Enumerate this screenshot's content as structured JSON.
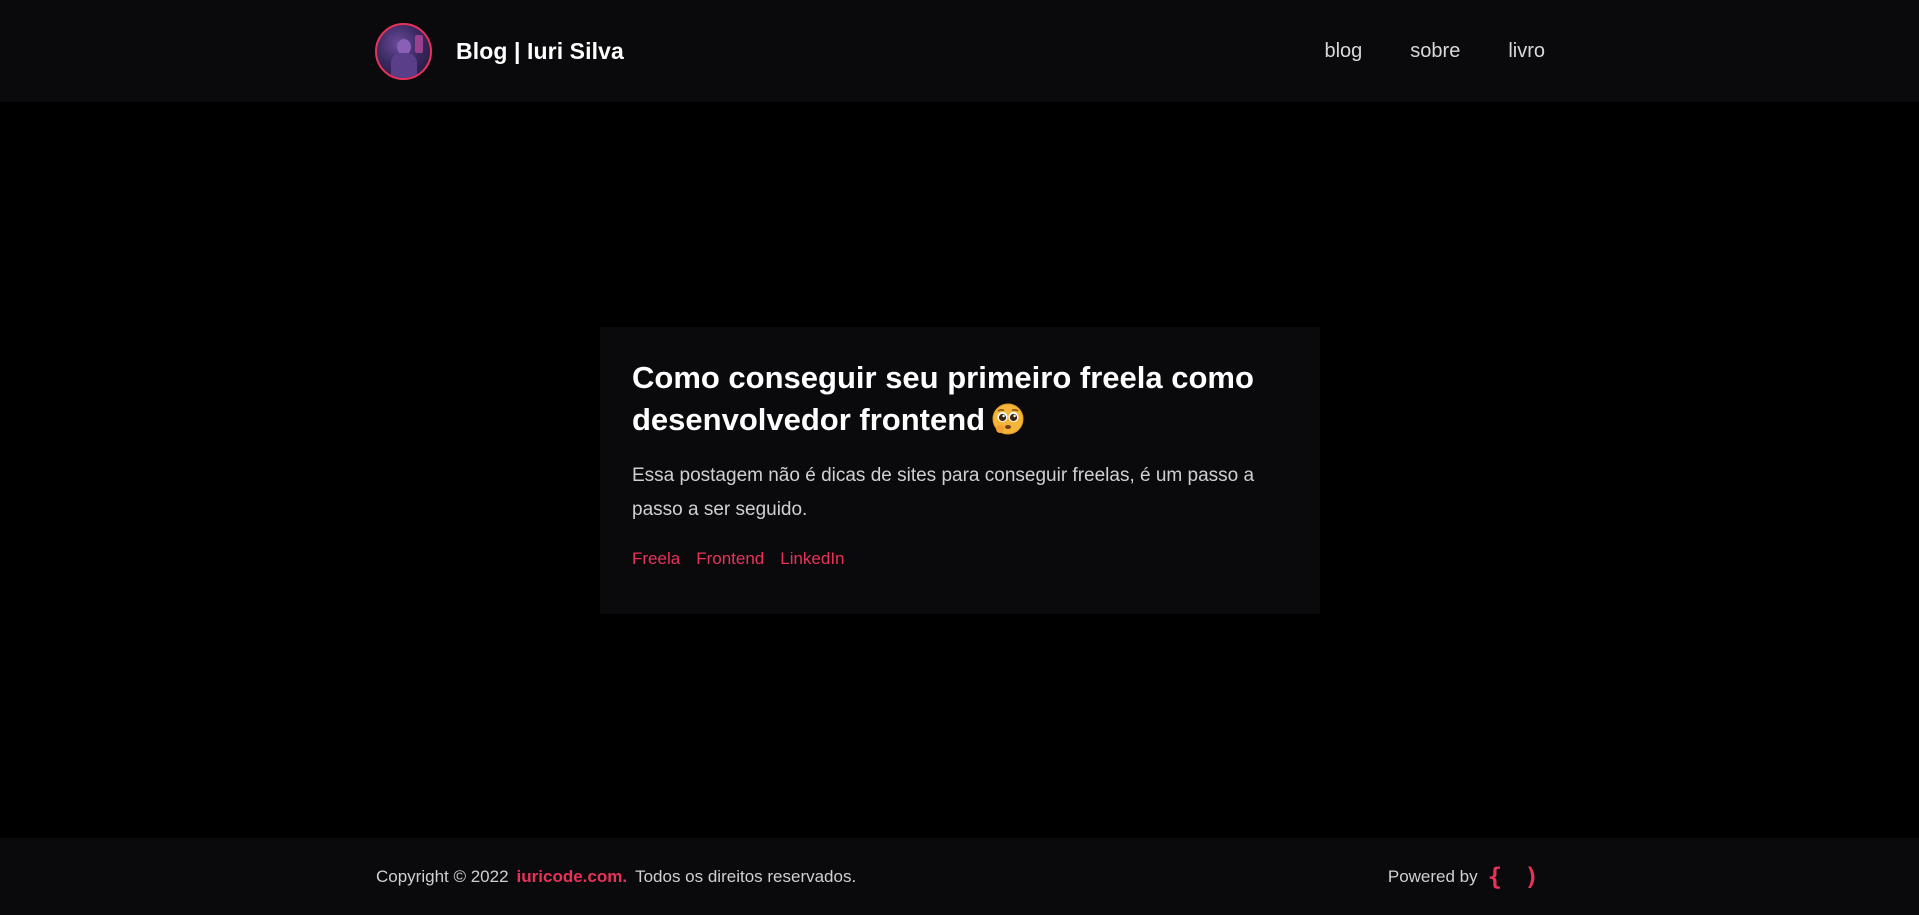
{
  "header": {
    "brand_title": "Blog | Iuri Silva",
    "avatar_icon": "profile-photo",
    "nav": {
      "blog": "blog",
      "sobre": "sobre",
      "livro": "livro"
    }
  },
  "post": {
    "title": "Como conseguir seu primeiro freela como desenvolvedor frontend",
    "emoji_icon": "pleading-face-emoji",
    "description": "Essa postagem não é dicas de sites para conseguir freelas, é um passo a passo a ser seguido.",
    "tags": [
      "Freela",
      "Frontend",
      "LinkedIn"
    ]
  },
  "footer": {
    "copyright_prefix": "Copyright © 2022",
    "site_link": "iuricode.com.",
    "rights": "Todos os direitos reservados.",
    "powered_by": "Powered by",
    "powered_logo": "{ )"
  },
  "colors": {
    "accent": "#e8325a",
    "background": "#000000",
    "surface": "#0a0a0c"
  }
}
